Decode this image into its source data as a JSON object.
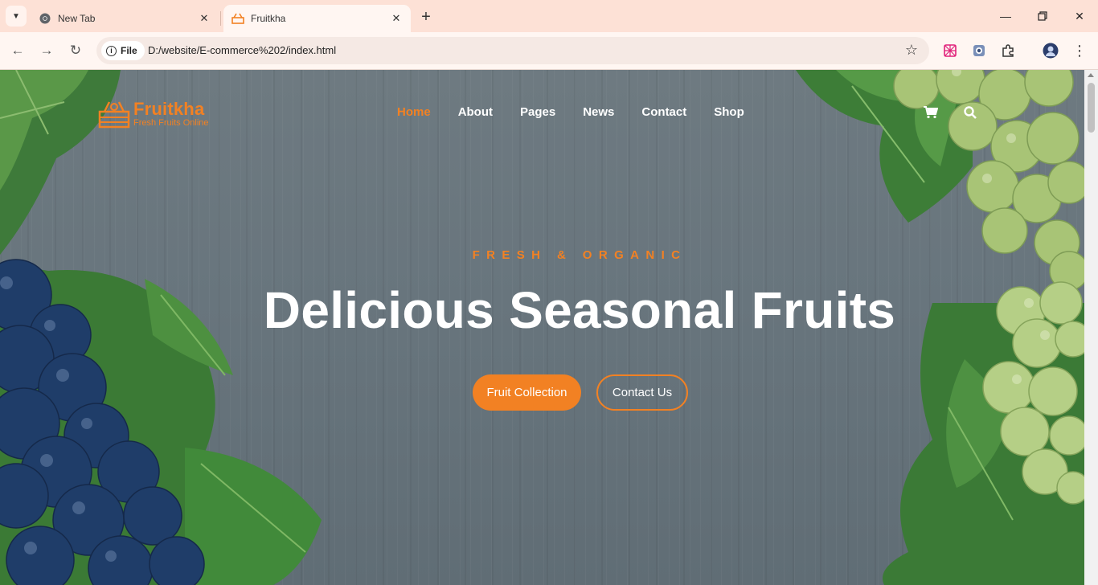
{
  "browser": {
    "tabs": [
      {
        "title": "New Tab",
        "active": false
      },
      {
        "title": "Fruitkha",
        "active": true
      }
    ],
    "address": {
      "scheme_chip": "File",
      "url": "D:/website/E-commerce%202/index.html"
    }
  },
  "site": {
    "logo": {
      "name": "Fruitkha",
      "tagline": "Fresh Fruits Online"
    },
    "nav": [
      {
        "label": "Home",
        "active": true
      },
      {
        "label": "About",
        "active": false
      },
      {
        "label": "Pages",
        "active": false
      },
      {
        "label": "News",
        "active": false
      },
      {
        "label": "Contact",
        "active": false
      },
      {
        "label": "Shop",
        "active": false
      }
    ],
    "hero": {
      "subtitle": "FRESH & ORGANIC",
      "title": "Delicious Seasonal Fruits",
      "primary_button": "Fruit Collection",
      "secondary_button": "Contact Us"
    },
    "icons": [
      "cart-icon",
      "search-icon"
    ]
  },
  "colors": {
    "accent": "#f28123",
    "chrome": "#fde1d6",
    "wood": "#6e7a81",
    "text": "#ffffff"
  }
}
